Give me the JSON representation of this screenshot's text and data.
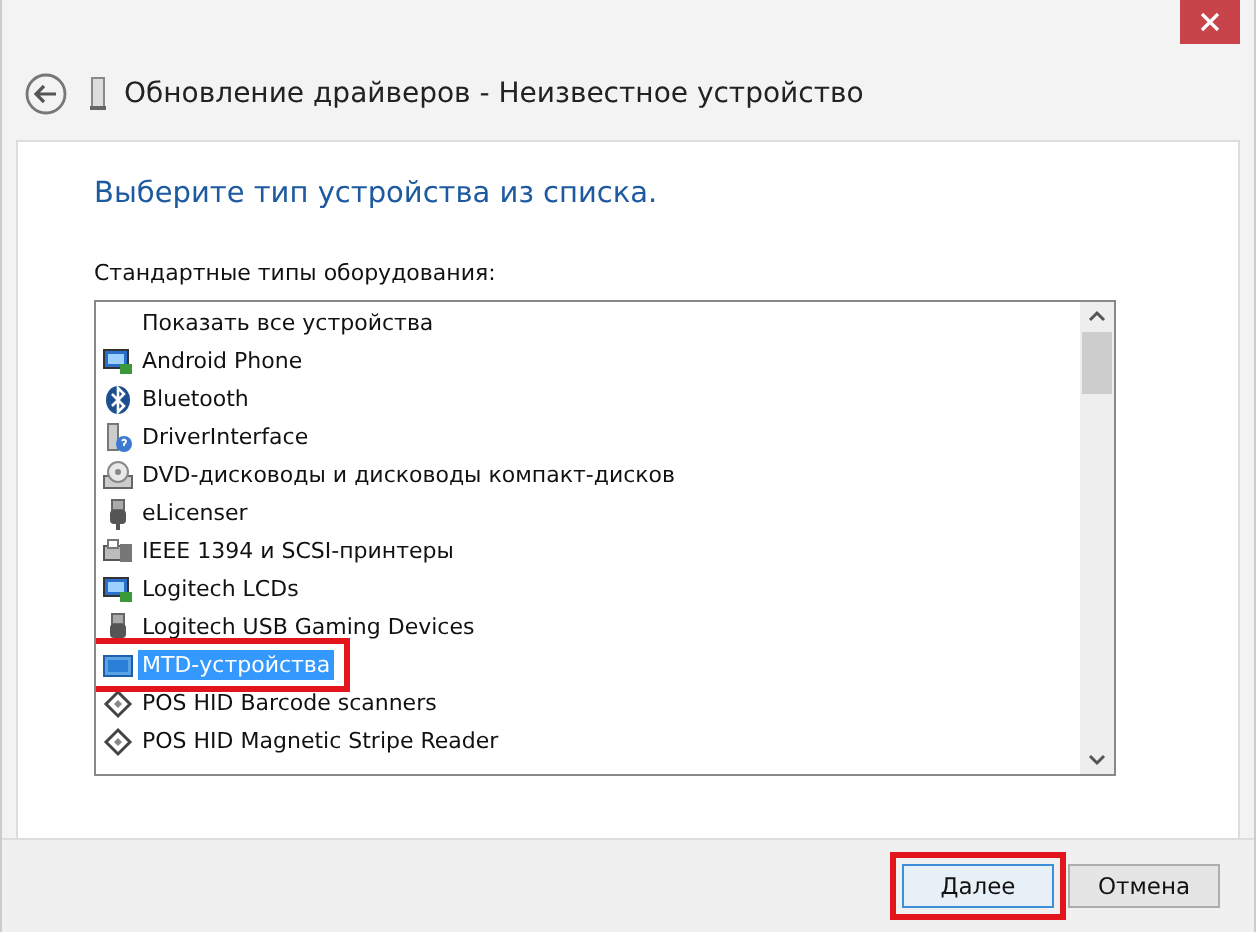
{
  "window": {
    "title": "Обновление драйверов - Неизвестное устройство"
  },
  "heading": "Выберите тип устройства из списка.",
  "list": {
    "label": "Стандартные типы оборудования:",
    "items": [
      {
        "text": "Показать все устройства",
        "kind": "none",
        "selected": false,
        "highlighted": false
      },
      {
        "text": "Android Phone",
        "kind": "monitor",
        "selected": false,
        "highlighted": false
      },
      {
        "text": "Bluetooth",
        "kind": "bluetooth",
        "selected": false,
        "highlighted": false
      },
      {
        "text": "DriverInterface",
        "kind": "help",
        "selected": false,
        "highlighted": false
      },
      {
        "text": "DVD-дисководы и дисководы компакт-дисков",
        "kind": "disc",
        "selected": false,
        "highlighted": false
      },
      {
        "text": "eLicenser",
        "kind": "usb",
        "selected": false,
        "highlighted": false
      },
      {
        "text": "IEEE 1394 и SCSI-принтеры",
        "kind": "printer",
        "selected": false,
        "highlighted": false
      },
      {
        "text": "Logitech LCDs",
        "kind": "monitor",
        "selected": false,
        "highlighted": false
      },
      {
        "text": "Logitech USB Gaming Devices",
        "kind": "usb",
        "selected": false,
        "highlighted": false
      },
      {
        "text": "MTD-устройства",
        "kind": "panel",
        "selected": true,
        "highlighted": true
      },
      {
        "text": "POS HID Barcode scanners",
        "kind": "diamond",
        "selected": false,
        "highlighted": false
      },
      {
        "text": "POS HID Magnetic Stripe Reader",
        "kind": "diamond",
        "selected": false,
        "highlighted": false
      }
    ]
  },
  "buttons": [
    {
      "label": "Далее",
      "highlighted": true,
      "default": true
    },
    {
      "label": "Отмена",
      "highlighted": false,
      "default": false
    }
  ]
}
